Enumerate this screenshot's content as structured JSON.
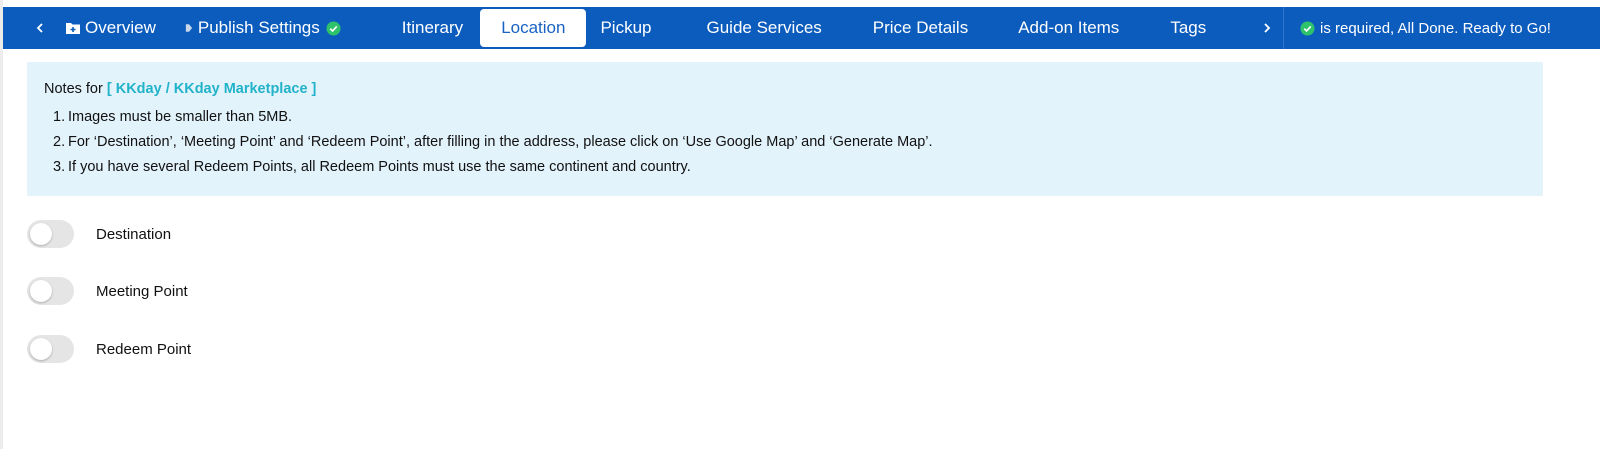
{
  "colors": {
    "nav_bg": "#0b5cbd",
    "active_tab_text": "#1a62c2",
    "success_check": "#2ec26b",
    "notes_bg": "#e3f3fc",
    "brand_accent": "#22b3c9",
    "toggle_off": "#e5e5e5"
  },
  "nav": {
    "prev_icon": "chevron-left-icon",
    "next_icon": "chevron-right-icon",
    "tabs": [
      {
        "label": "Overview",
        "icon": "folder-add-icon"
      },
      {
        "label": "Publish Settings",
        "icon": "tag-icon",
        "done": true
      },
      {
        "label": "Itinerary"
      },
      {
        "label": "Location",
        "active": true
      },
      {
        "label": "Pickup"
      },
      {
        "label": "Guide Services"
      },
      {
        "label": "Price Details"
      },
      {
        "label": "Add-on Items"
      },
      {
        "label": "Tags"
      }
    ],
    "status_text": "is required,  All Done. Ready to Go!"
  },
  "notes": {
    "prefix": "Notes for",
    "brand": "[ KKday / KKday Marketplace ]",
    "items": [
      {
        "num": "1.",
        "text": "Images must be smaller than 5MB."
      },
      {
        "num": "2.",
        "text": "For ‘Destination’, ‘Meeting Point’ and ‘Redeem Point’, after filling in the address, please click on ‘Use Google Map’ and ‘Generate Map’."
      },
      {
        "num": "3.",
        "text": "If you have several Redeem Points, all Redeem Points must use the same continent and country."
      }
    ]
  },
  "toggles": [
    {
      "label": "Destination",
      "on": false
    },
    {
      "label": "Meeting Point",
      "on": false
    },
    {
      "label": "Redeem Point",
      "on": false
    }
  ]
}
